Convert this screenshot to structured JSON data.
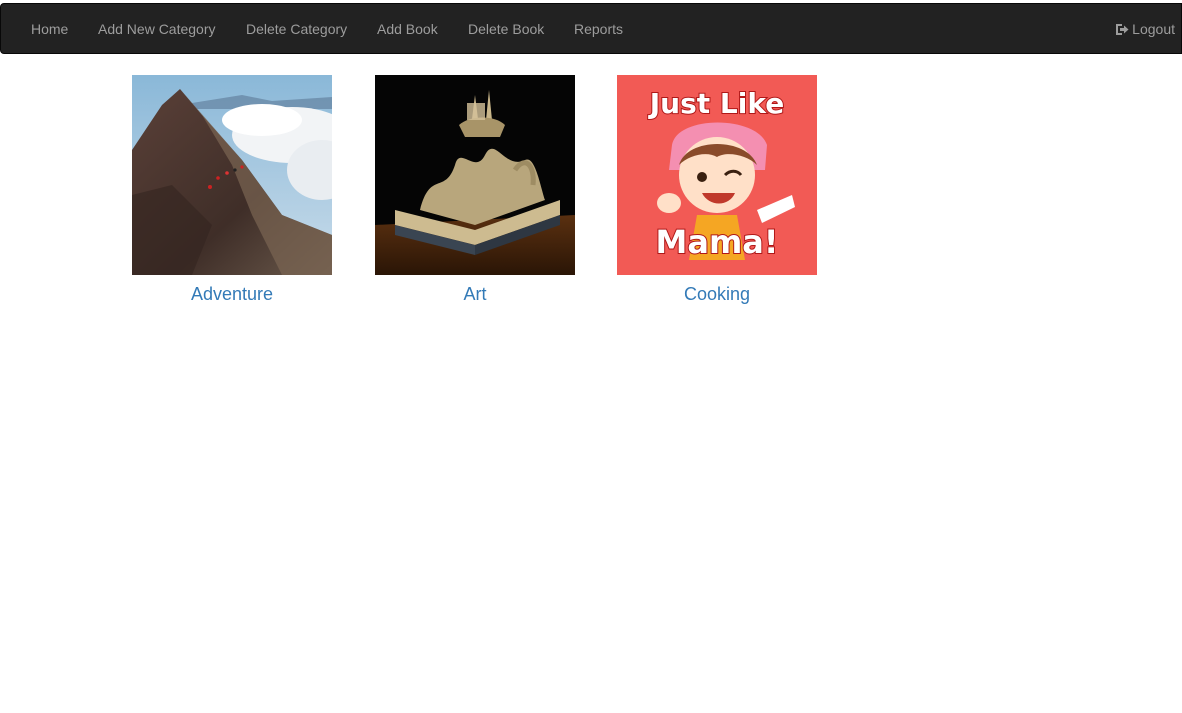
{
  "navbar": {
    "items": [
      {
        "label": "Home"
      },
      {
        "label": "Add New Category"
      },
      {
        "label": "Delete Category"
      },
      {
        "label": "Add Book"
      },
      {
        "label": "Delete Book"
      },
      {
        "label": "Reports"
      }
    ],
    "logout": {
      "label": "Logout",
      "icon": "logout-icon"
    }
  },
  "categories": [
    {
      "label": "Adventure",
      "image": "mountain-ridge-photo"
    },
    {
      "label": "Art",
      "image": "book-sculpture-photo"
    },
    {
      "label": "Cooking",
      "image": "just-like-mama-cover",
      "image_text": "Just Like Mama!"
    }
  ],
  "colors": {
    "navbar_bg": "#222222",
    "nav_text": "#9d9d9d",
    "link": "#337ab7",
    "cooking_bg": "#f25a55"
  }
}
